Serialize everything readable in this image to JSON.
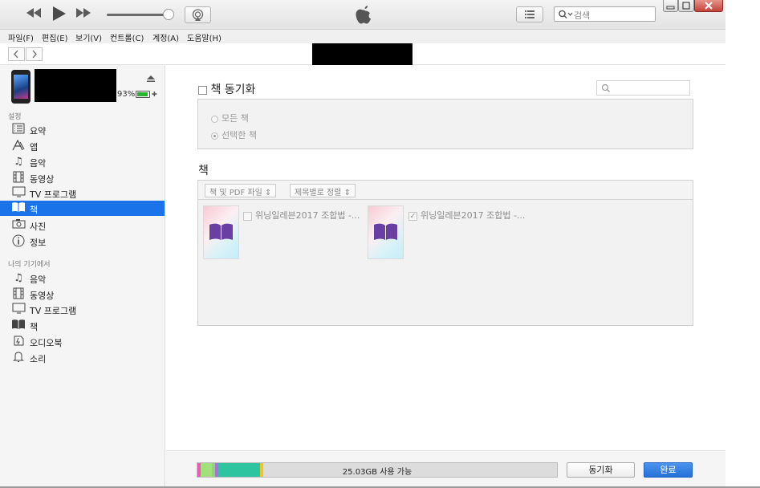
{
  "player": {
    "rewind_icon": "rewind-icon",
    "play_icon": "play-icon",
    "forward_icon": "fast-forward-icon",
    "volume_level": 0.9,
    "search_placeholder": "검색"
  },
  "menu": {
    "items": [
      "파일(F)",
      "편집(E)",
      "보기(V)",
      "컨트롤(C)",
      "계정(A)",
      "도움말(H)"
    ]
  },
  "device": {
    "battery_pct": "93%",
    "battery_level": 0.93
  },
  "sidebar": {
    "settings_header": "설정",
    "settings_items": [
      {
        "label": "요약",
        "icon": "summary-icon"
      },
      {
        "label": "앱",
        "icon": "apps-icon"
      },
      {
        "label": "음악",
        "icon": "music-note-icon"
      },
      {
        "label": "동영상",
        "icon": "film-icon"
      },
      {
        "label": "TV 프로그램",
        "icon": "tv-icon"
      },
      {
        "label": "책",
        "icon": "book-icon",
        "active": true
      },
      {
        "label": "사진",
        "icon": "camera-icon"
      },
      {
        "label": "정보",
        "icon": "info-icon"
      }
    ],
    "mydevice_header": "나의 기기에서",
    "mydevice_items": [
      {
        "label": "음악",
        "icon": "music-note-icon"
      },
      {
        "label": "동영상",
        "icon": "film-icon"
      },
      {
        "label": "TV 프로그램",
        "icon": "tv-icon"
      },
      {
        "label": "책",
        "icon": "book-icon"
      },
      {
        "label": "오디오북",
        "icon": "audiobook-icon"
      },
      {
        "label": "소리",
        "icon": "bell-icon"
      }
    ]
  },
  "main": {
    "sync_label": "책 동기화",
    "radio_all": "모든 책",
    "radio_selected": "선택한 책",
    "books_header": "책",
    "filter_select": "책 및 PDF 파일",
    "sort_select": "제목별로 정렬",
    "books": [
      {
        "title": "위닝일레븐2017 조합법 -...",
        "checked": false
      },
      {
        "title": "위닝일레븐2017 조합법 -...",
        "checked": true
      }
    ]
  },
  "bottom": {
    "storage_label": "25.03GB 사용 가능",
    "sync_button": "동기화",
    "done_button": "완료",
    "segments": [
      {
        "color": "#e55db8",
        "fraction": 0.008
      },
      {
        "color": "#a2e07a",
        "fraction": 0.032
      },
      {
        "color": "#8fd37f",
        "fraction": 0.008
      },
      {
        "color": "#b36be0",
        "fraction": 0.01
      },
      {
        "color": "#2ec4a0",
        "fraction": 0.117
      },
      {
        "color": "#f2c22b",
        "fraction": 0.008
      }
    ]
  }
}
